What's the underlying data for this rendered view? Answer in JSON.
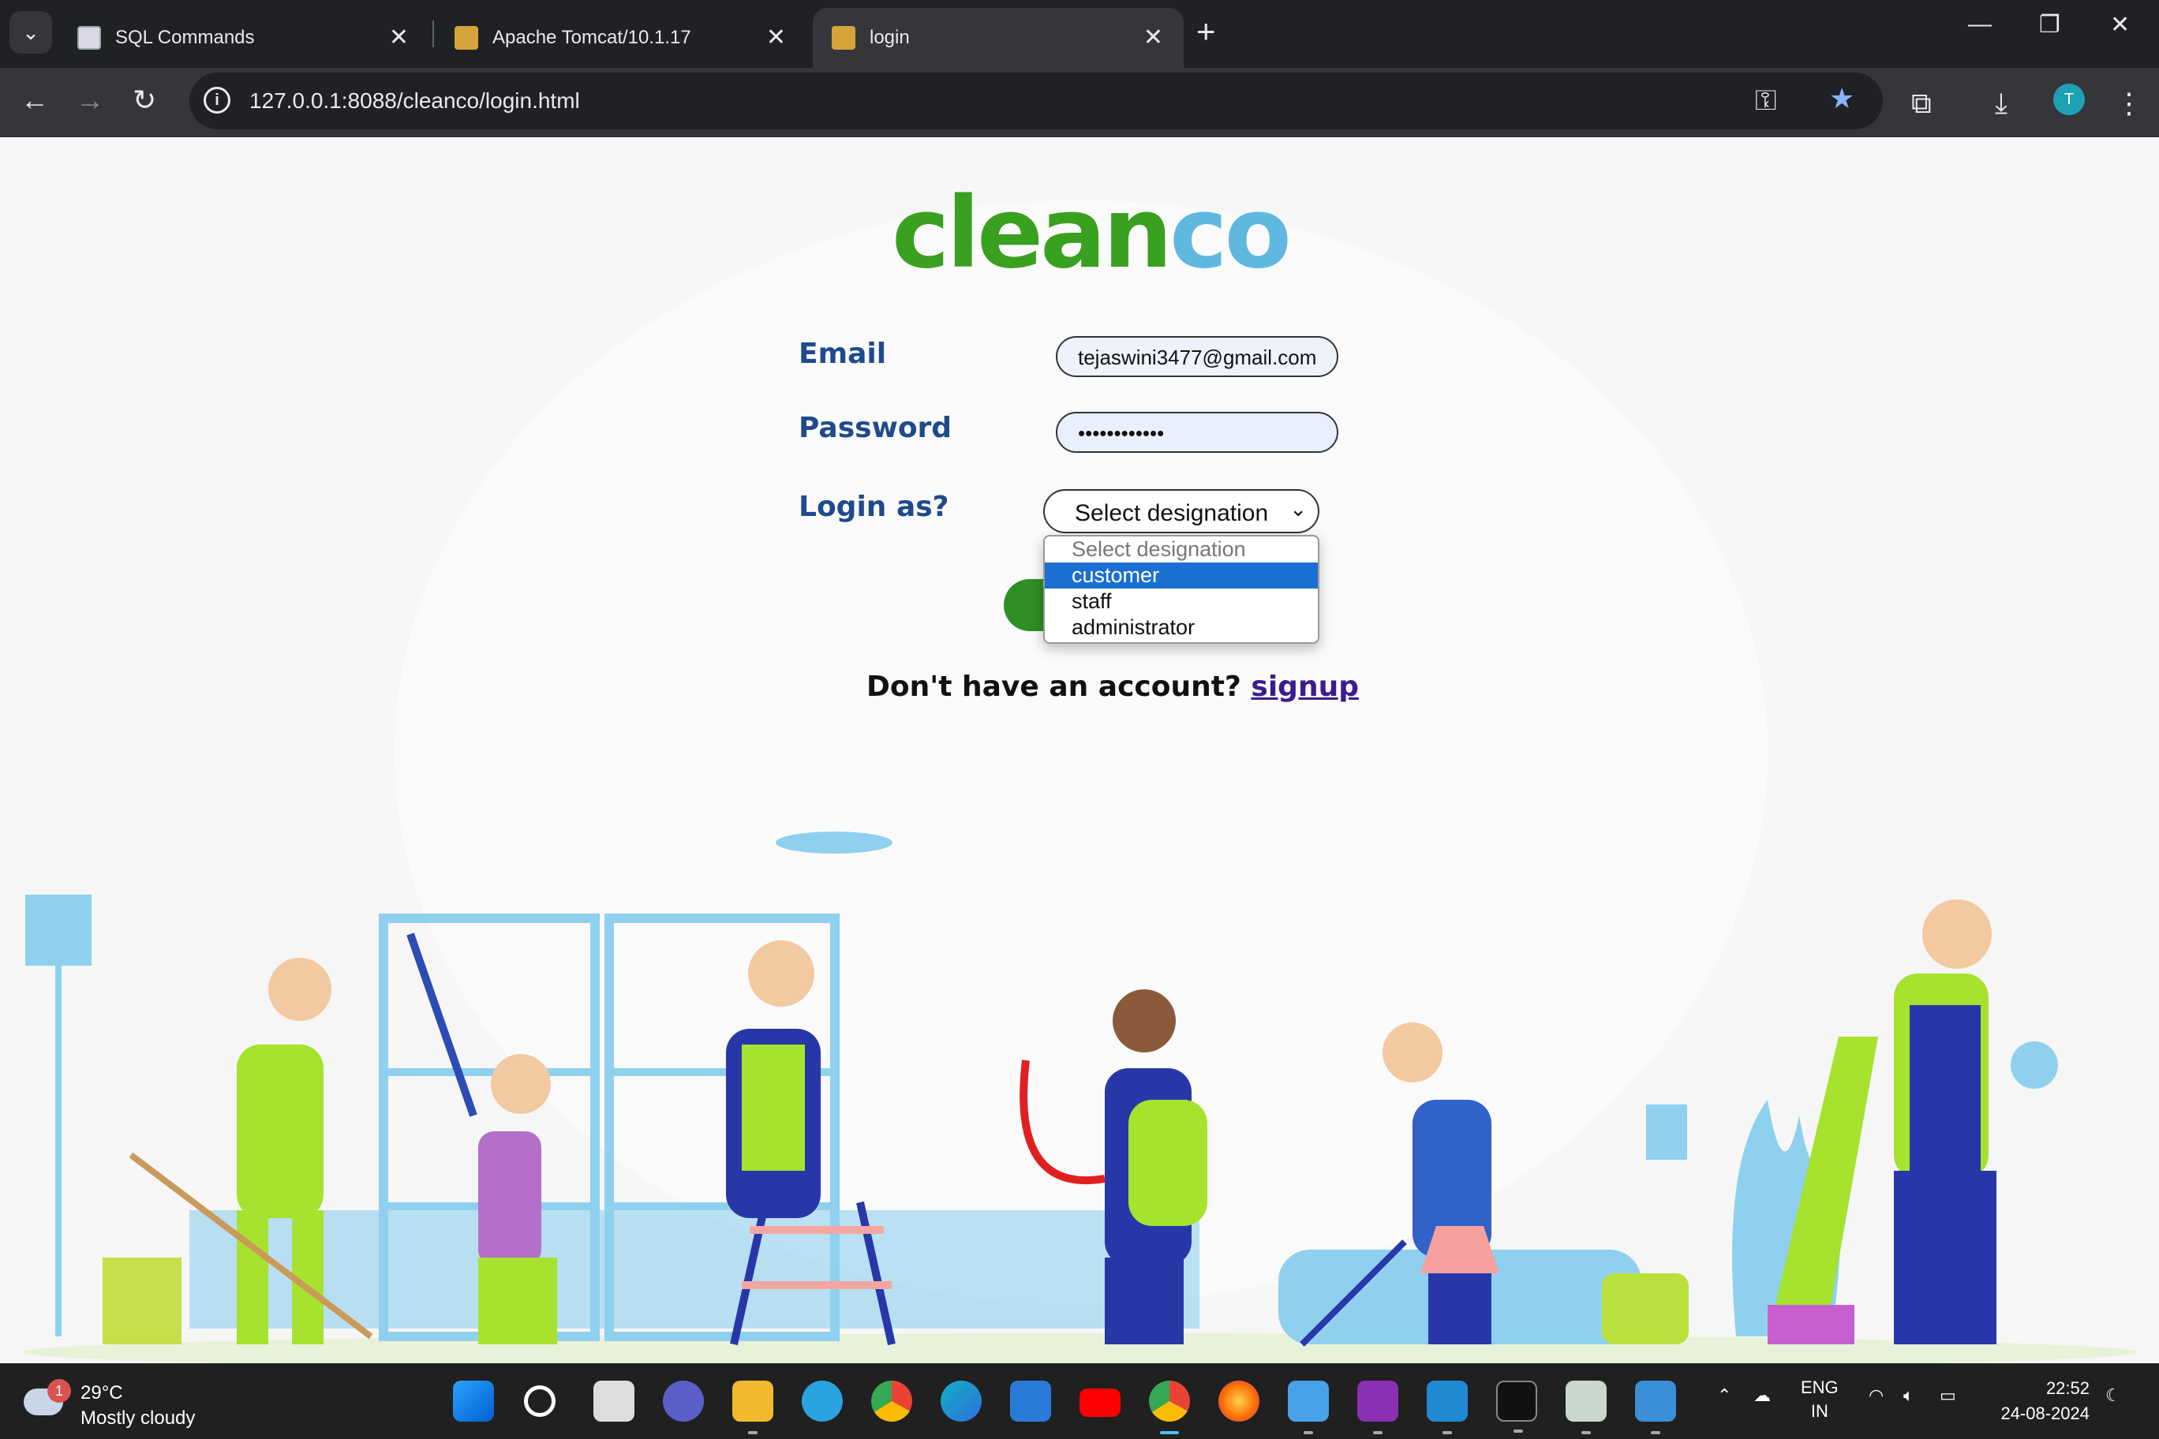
{
  "browser": {
    "tabs": [
      {
        "title": "SQL Commands"
      },
      {
        "title": "Apache Tomcat/10.1.17"
      },
      {
        "title": "login"
      }
    ],
    "address": "127.0.0.1:8088/cleanco/login.html"
  },
  "page": {
    "logo": {
      "part1": "clean",
      "part2": "co"
    },
    "form": {
      "email_label": "Email",
      "email_value": "tejaswini3477@gmail.com",
      "password_label": "Password",
      "password_value": "••••••••••••",
      "login_as_label": "Login as?",
      "select_value": "Select designation",
      "options": [
        "Select designation",
        "customer",
        "staff",
        "administrator"
      ],
      "highlighted_option": "customer"
    },
    "signup": {
      "text": "Don't have an account?",
      "link": "signup"
    }
  },
  "taskbar": {
    "weather": {
      "badge": "1",
      "temp": "29°C",
      "condition": "Mostly cloudy"
    },
    "lang": {
      "line1": "ENG",
      "line2": "IN"
    },
    "clock": {
      "time": "22:52",
      "date": "24-08-2024"
    }
  },
  "colors": {
    "logo_green": "#3aa01f",
    "logo_blue": "#5fb8de",
    "label_blue": "#1f4a8c",
    "button_green": "#2f8e25",
    "highlight": "#1b6fd1"
  }
}
